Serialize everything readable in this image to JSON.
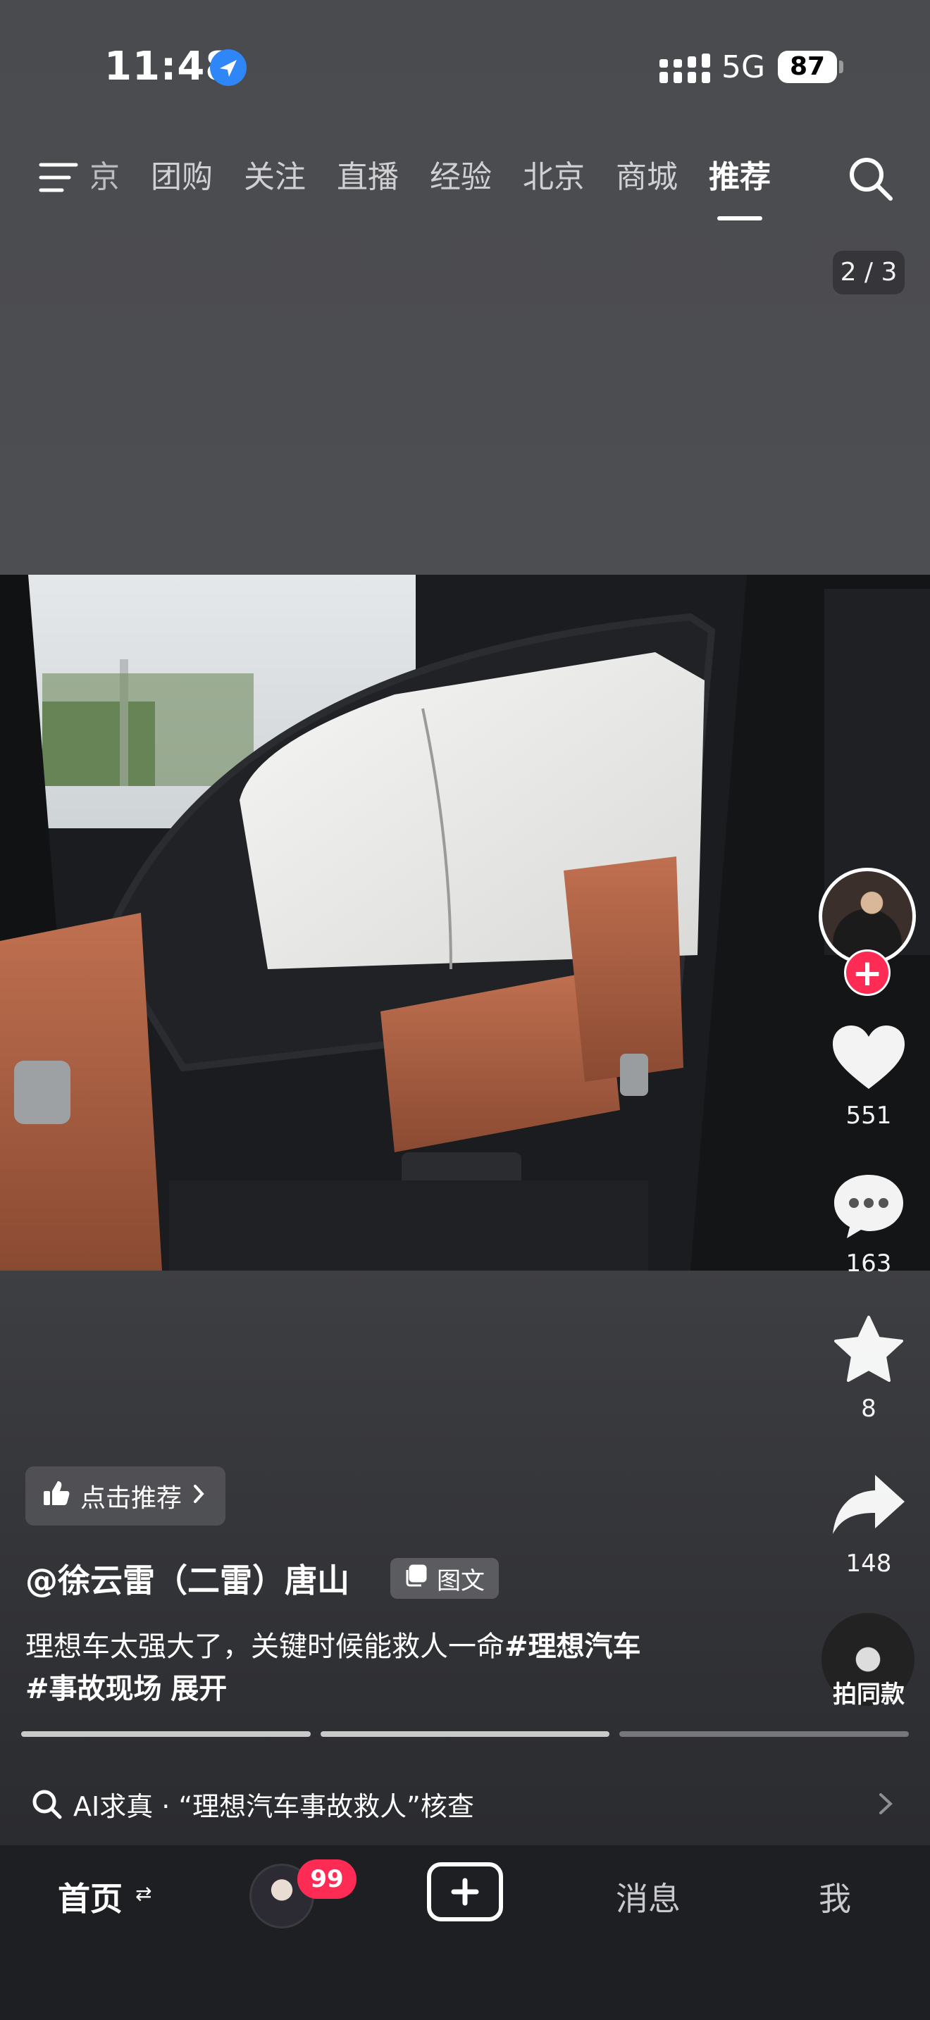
{
  "status_bar": {
    "time": "11:48",
    "network": "5G",
    "battery": "87"
  },
  "top_nav": {
    "tabs": [
      {
        "label": "京"
      },
      {
        "label": "团购"
      },
      {
        "label": "关注"
      },
      {
        "label": "直播"
      },
      {
        "label": "经验"
      },
      {
        "label": "北京"
      },
      {
        "label": "商城"
      },
      {
        "label": "推荐",
        "active": true
      }
    ]
  },
  "post": {
    "page_indicator": "2 / 3",
    "author": "@徐云雷（二雷）唐山",
    "type_badge": "图文",
    "recommend_chip": "点击推荐",
    "description_text": "理想车太强大了，关键时候能救人一命",
    "tags": [
      "#理想汽车",
      "#事故现场"
    ],
    "expand_label": "展开",
    "image_progress": {
      "current": 2,
      "total": 3
    }
  },
  "actions": {
    "likes": "551",
    "comments": "163",
    "favorites": "8",
    "shares": "148",
    "same_style_label": "拍同款"
  },
  "ai_bar": {
    "text": "AI求真 · “理想汽车事故救人”核查"
  },
  "bottom_nav": {
    "home": "首页",
    "home_swap_icon": "⇄",
    "friends_badge": "99",
    "messages": "消息",
    "me": "我"
  },
  "colors": {
    "accent_red": "#fe2c55",
    "location_blue": "#2f86f6"
  }
}
